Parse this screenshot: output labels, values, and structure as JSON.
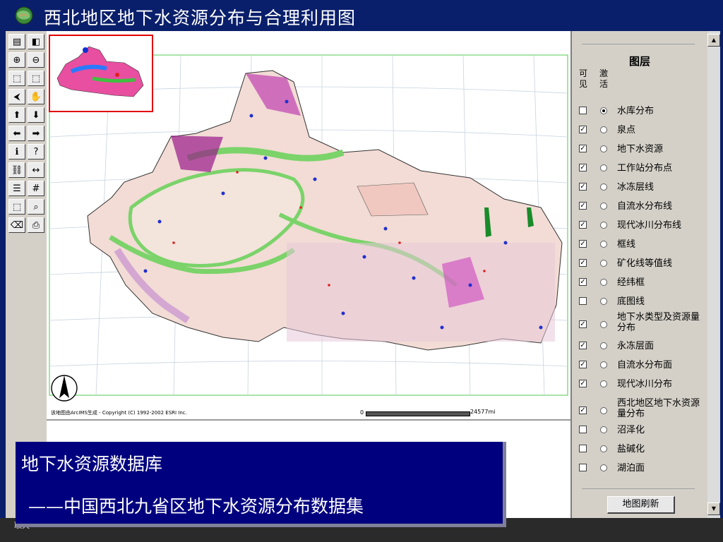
{
  "window": {
    "title": "西北地区地下水资源分布与合理利用图"
  },
  "toolbar": {
    "buttons": [
      {
        "icon": "legend-icon",
        "glyph": "▤"
      },
      {
        "icon": "overview-icon",
        "glyph": "◧"
      },
      {
        "icon": "zoom-in-icon",
        "glyph": "⊕"
      },
      {
        "icon": "zoom-out-icon",
        "glyph": "⊖"
      },
      {
        "icon": "full-extent-icon",
        "glyph": "⬚"
      },
      {
        "icon": "zoom-active-icon",
        "glyph": "⬚"
      },
      {
        "icon": "back-icon",
        "glyph": "⮜"
      },
      {
        "icon": "pan-hand-icon",
        "glyph": "✋"
      },
      {
        "icon": "pan-up-icon",
        "glyph": "⬆"
      },
      {
        "icon": "pan-down-icon",
        "glyph": "⬇"
      },
      {
        "icon": "pan-left-icon",
        "glyph": "⬅"
      },
      {
        "icon": "pan-right-icon",
        "glyph": "➡"
      },
      {
        "icon": "identify-icon",
        "glyph": "ℹ"
      },
      {
        "icon": "query-icon",
        "glyph": "?"
      },
      {
        "icon": "find-binoculars-icon",
        "glyph": "⛓"
      },
      {
        "icon": "measure-icon",
        "glyph": "↔"
      },
      {
        "icon": "attribute-table-icon",
        "glyph": "☰"
      },
      {
        "icon": "grid-icon",
        "glyph": "#"
      },
      {
        "icon": "select-rectangle-icon",
        "glyph": "⬚"
      },
      {
        "icon": "select-magnifier-icon",
        "glyph": "⌕"
      },
      {
        "icon": "eraser-icon",
        "glyph": "⌫"
      },
      {
        "icon": "print-icon",
        "glyph": "⎙"
      }
    ]
  },
  "map": {
    "credit": "该地图由ArcIMS生成 - Copyright (C) 1992-2002 ESRI Inc.",
    "scale_zero": "0",
    "scale_label": "24577mi"
  },
  "layers": {
    "title": "图层",
    "col_visible": [
      "可",
      "见"
    ],
    "col_active": [
      "激",
      "活"
    ],
    "refresh_label": "地图刷新",
    "items": [
      {
        "name": "水库分布",
        "visible": false,
        "active": true
      },
      {
        "name": "泉点",
        "visible": true,
        "active": false
      },
      {
        "name": "地下水资源",
        "visible": true,
        "active": false
      },
      {
        "name": "工作站分布点",
        "visible": true,
        "active": false
      },
      {
        "name": "冰冻层线",
        "visible": true,
        "active": false
      },
      {
        "name": "自流水分布线",
        "visible": true,
        "active": false
      },
      {
        "name": "现代冰川分布线",
        "visible": true,
        "active": false
      },
      {
        "name": "框线",
        "visible": true,
        "active": false
      },
      {
        "name": "矿化线等值线",
        "visible": true,
        "active": false
      },
      {
        "name": "经纬框",
        "visible": true,
        "active": false
      },
      {
        "name": "底图线",
        "visible": false,
        "active": false
      },
      {
        "name": "地下水类型及资源量分布",
        "visible": true,
        "active": false
      },
      {
        "name": "永冻层面",
        "visible": true,
        "active": false
      },
      {
        "name": "自流水分布面",
        "visible": true,
        "active": false
      },
      {
        "name": "现代冰川分布",
        "visible": true,
        "active": false
      },
      {
        "name": "西北地区地下水资源量分布",
        "visible": true,
        "active": false
      },
      {
        "name": "沼泽化",
        "visible": false,
        "active": false
      },
      {
        "name": "盐碱化",
        "visible": false,
        "active": false
      },
      {
        "name": "湖泊面",
        "visible": false,
        "active": false
      }
    ]
  },
  "caption": {
    "line1": "地下水资源数据库",
    "line2": "——中国西北九省区地下水资源分布数据集"
  },
  "status": {
    "text": "取天"
  },
  "colors": {
    "titlebar": "#0a1f6b",
    "panel": "#d4d0c8",
    "caption_bg": "#00007f",
    "overview_border": "#e00000",
    "map_grid": "#70d070"
  }
}
